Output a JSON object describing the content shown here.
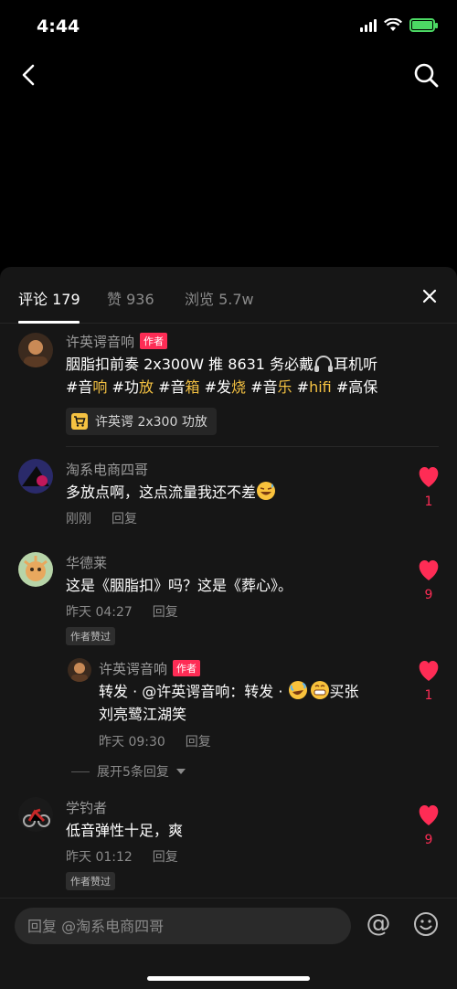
{
  "status_bar": {
    "time": "4:44"
  },
  "sheet": {
    "tabs": [
      {
        "label": "评论 179",
        "active": true
      },
      {
        "label": "赞 936",
        "active": false
      },
      {
        "label": "浏览 5.7w",
        "active": false
      }
    ]
  },
  "post": {
    "author": "许英谔音响",
    "author_tag": "作者",
    "line1": "胭脂扣前奏 2x300W 推 8631 务必戴",
    "line1_tail": "耳机听",
    "hashtags": [
      {
        "prefix": "#音",
        "hl": "响"
      },
      {
        "prefix": "#功",
        "hl": "放"
      },
      {
        "prefix": "#音",
        "hl": "箱"
      },
      {
        "prefix": "#发",
        "hl": "烧"
      },
      {
        "prefix": "#音",
        "hl": "乐"
      },
      {
        "prefix": "#",
        "hl": "hifi"
      },
      {
        "prefix": "#高保",
        "hl": ""
      }
    ],
    "product_label": "许英谔 2x300 功放"
  },
  "comments": [
    {
      "name": "淘系电商四哥",
      "text": "多放点啊，这点流量我还不差",
      "time": "刚刚",
      "reply": "回复",
      "likes": "1"
    },
    {
      "name": "华德莱",
      "text": "这是《胭脂扣》吗？这是《葬心》。",
      "time": "昨天 04:27",
      "reply": "回复",
      "likes": "9",
      "badge": "作者赞过"
    },
    {
      "name": "许英谔音响",
      "author_tag": "作者",
      "text_line1": "转发 · @许英谔音响：转发 · ",
      "text_line1_tail": "买张",
      "text_line2": "刘亮鹭江湖笑",
      "time": "昨天 09:30",
      "reply": "回复",
      "likes": "1"
    },
    {
      "name": "学钓者",
      "text": "低音弹性十足，爽",
      "time": "昨天 01:12",
      "reply": "回复",
      "likes": "9",
      "badge": "作者赞过"
    }
  ],
  "expand_label": "展开5条回复",
  "reply_bar": {
    "placeholder": "回复 @淘系电商四哥"
  },
  "colors": {
    "accent": "#fe2c55",
    "hashtag": "#f5c242",
    "sheet_bg": "#161616"
  }
}
